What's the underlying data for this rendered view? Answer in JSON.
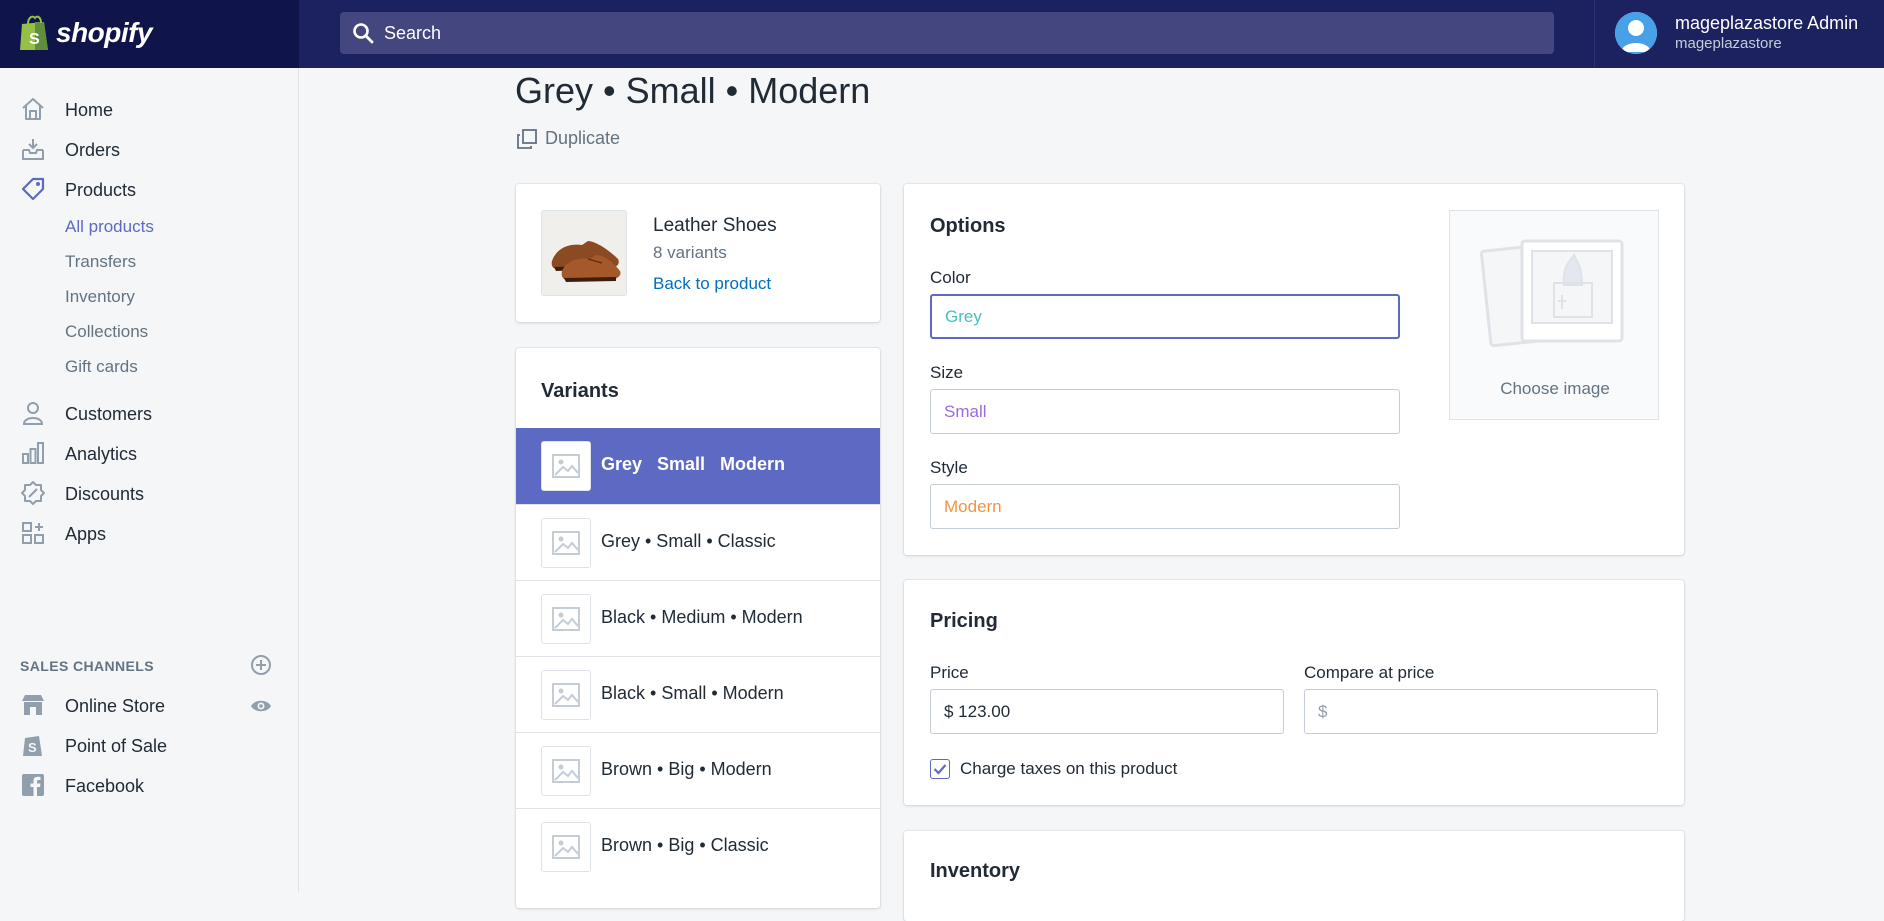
{
  "header": {
    "brand": "shopify",
    "search_placeholder": "Search",
    "user_name": "mageplazastore Admin",
    "user_store": "mageplazastore"
  },
  "sidebar": {
    "items": [
      {
        "label": "Home",
        "icon": "home-icon"
      },
      {
        "label": "Orders",
        "icon": "orders-icon"
      },
      {
        "label": "Products",
        "icon": "products-icon"
      },
      {
        "label": "Customers",
        "icon": "customers-icon"
      },
      {
        "label": "Analytics",
        "icon": "analytics-icon"
      },
      {
        "label": "Discounts",
        "icon": "discounts-icon"
      },
      {
        "label": "Apps",
        "icon": "apps-icon"
      }
    ],
    "product_subitems": [
      "All products",
      "Transfers",
      "Inventory",
      "Collections",
      "Gift cards"
    ],
    "sales_channels_title": "SALES CHANNELS",
    "channels": [
      {
        "label": "Online Store",
        "icon": "online-store-icon"
      },
      {
        "label": "Point of Sale",
        "icon": "point-of-sale-icon"
      },
      {
        "label": "Facebook",
        "icon": "facebook-icon"
      }
    ]
  },
  "page": {
    "title": "Grey • Small • Modern",
    "duplicate_label": "Duplicate"
  },
  "product": {
    "name": "Leather Shoes",
    "variant_count": "8 variants",
    "back_link": "Back to product"
  },
  "variants": {
    "title": "Variants",
    "items": [
      {
        "label": "Grey   Small   Modern",
        "active": true
      },
      {
        "label": "Grey • Small • Classic"
      },
      {
        "label": "Black • Medium • Modern"
      },
      {
        "label": "Black • Small • Modern"
      },
      {
        "label": "Brown • Big • Modern"
      },
      {
        "label": "Brown • Big • Classic"
      }
    ]
  },
  "options": {
    "title": "Options",
    "color_label": "Color",
    "color_value": "Grey",
    "size_label": "Size",
    "size_value": "Small",
    "style_label": "Style",
    "style_value": "Modern",
    "choose_image": "Choose image"
  },
  "pricing": {
    "title": "Pricing",
    "price_label": "Price",
    "price_value": "$ 123.00",
    "compare_label": "Compare at price",
    "compare_placeholder": "$",
    "charge_taxes_label": "Charge taxes on this product",
    "charge_taxes_checked": true
  },
  "inventory": {
    "title": "Inventory"
  },
  "colors": {
    "topbar": "#1c2260",
    "accent": "#5c6ac4",
    "link": "#006fbb",
    "color_value": "#47c1bf",
    "size_value": "#9c6ade",
    "style_value": "#f49342"
  }
}
